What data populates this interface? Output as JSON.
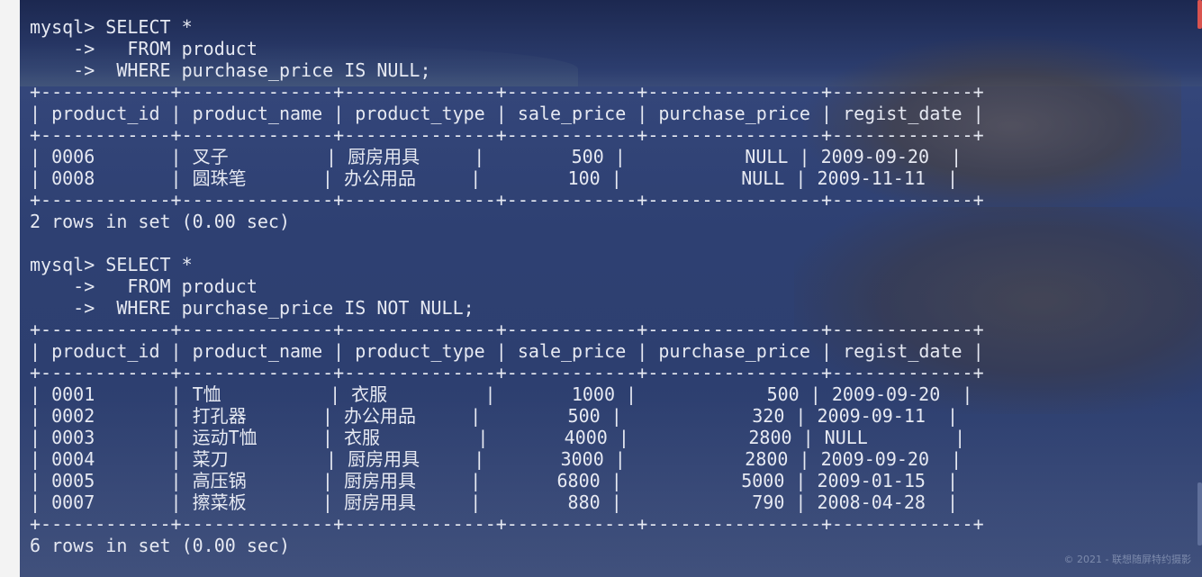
{
  "terminal": {
    "lines": [
      "mysql> SELECT *",
      "    ->   FROM product",
      "    ->  WHERE purchase_price IS NULL;",
      "+------------+--------------+--------------+------------+----------------+-------------+",
      "| product_id | product_name | product_type | sale_price | purchase_price | regist_date |",
      "+------------+--------------+--------------+------------+----------------+-------------+",
      "| 0006       | 叉子         | 厨房用具     |        500 |           NULL | 2009-09-20  |",
      "| 0008       | 圆珠笔       | 办公用品     |        100 |           NULL | 2009-11-11  |",
      "+------------+--------------+--------------+------------+----------------+-------------+",
      "2 rows in set (0.00 sec)",
      "",
      "mysql> SELECT *",
      "    ->   FROM product",
      "    ->  WHERE purchase_price IS NOT NULL;",
      "+------------+--------------+--------------+------------+----------------+-------------+",
      "| product_id | product_name | product_type | sale_price | purchase_price | regist_date |",
      "+------------+--------------+--------------+------------+----------------+-------------+",
      "| 0001       | T恤          | 衣服         |       1000 |            500 | 2009-09-20  |",
      "| 0002       | 打孔器       | 办公用品     |        500 |            320 | 2009-09-11  |",
      "| 0003       | 运动T恤      | 衣服         |       4000 |           2800 | NULL        |",
      "| 0004       | 菜刀         | 厨房用具     |       3000 |           2800 | 2009-09-20  |",
      "| 0005       | 高压锅       | 厨房用具     |       6800 |           5000 | 2009-01-15  |",
      "| 0007       | 擦菜板       | 厨房用具     |        880 |            790 | 2008-04-28  |",
      "+------------+--------------+--------------+------------+----------------+-------------+",
      "6 rows in set (0.00 sec)"
    ]
  },
  "watermark": "© 2021 - 联想随屏特约摄影"
}
